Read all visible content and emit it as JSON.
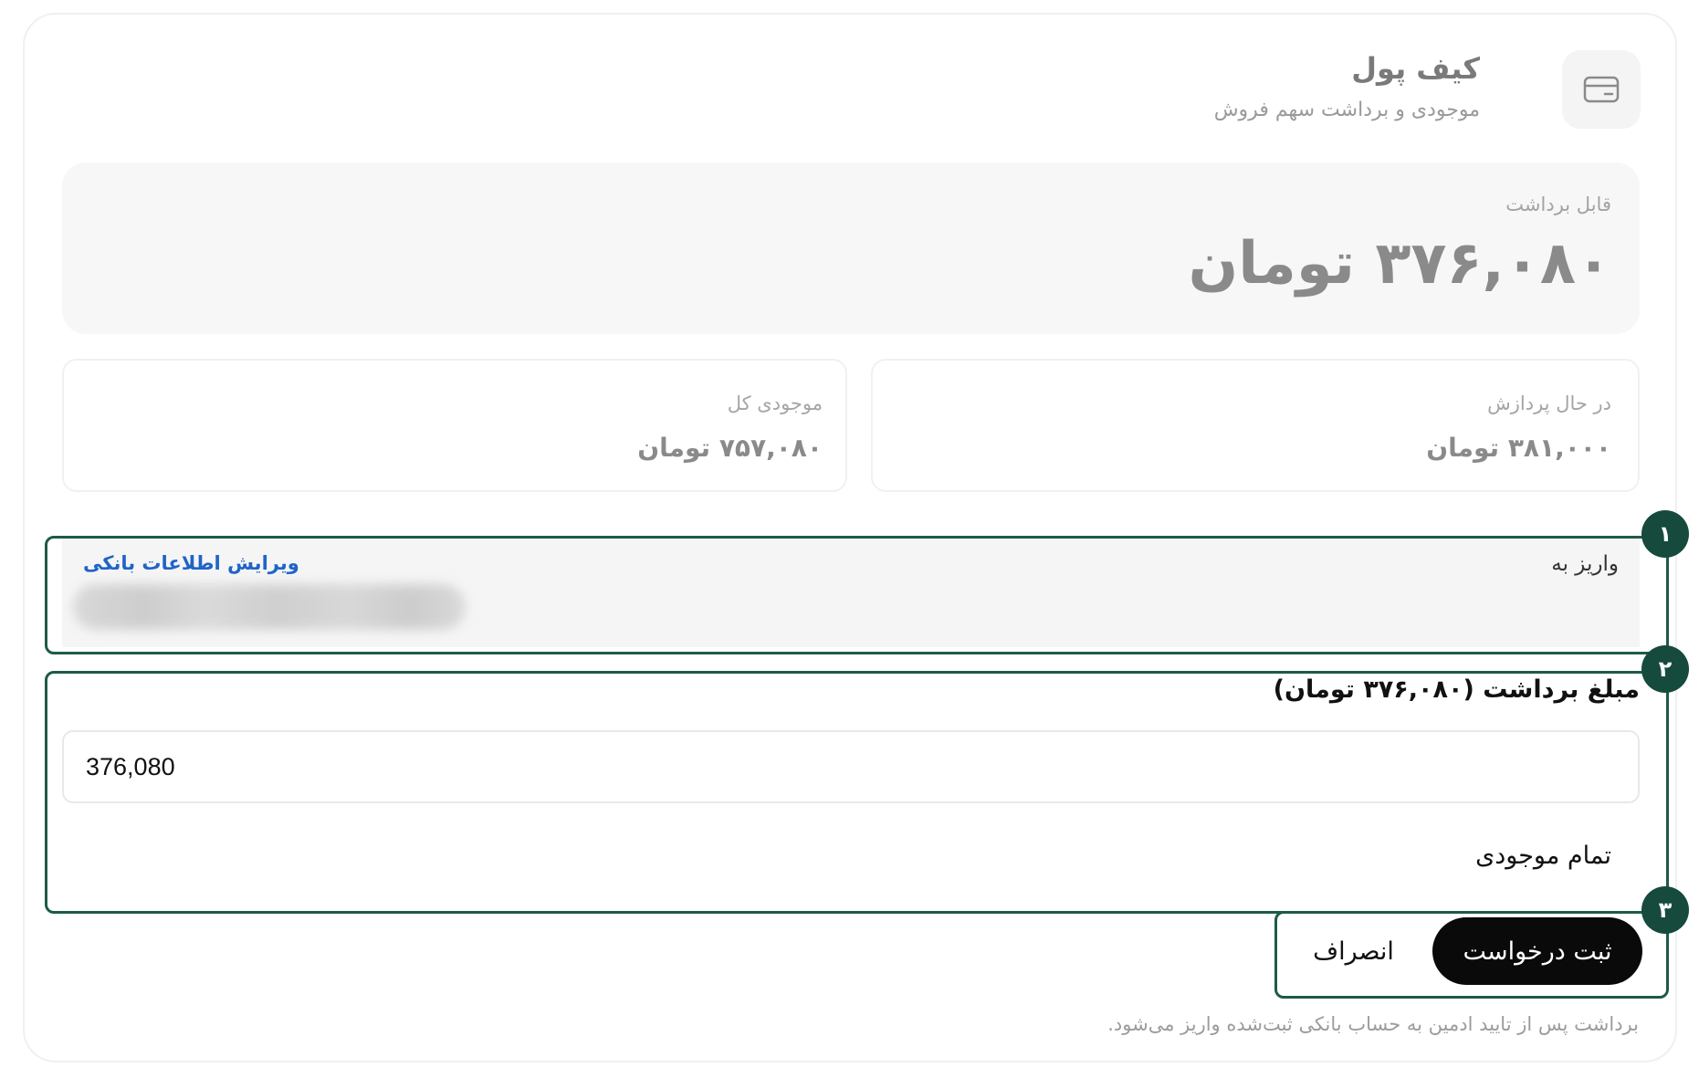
{
  "header": {
    "icon": "wallet-card-icon",
    "title": "کیف پول",
    "subtitle": "موجودی و برداشت سهم فروش"
  },
  "withdrawable": {
    "label": "قابل برداشت",
    "amount": "۳۷۶,۰۸۰ تومان"
  },
  "stats": {
    "processing": {
      "label": "در حال پردازش",
      "value": "۳۸۱,۰۰۰ تومان"
    },
    "total": {
      "label": "موجودی کل",
      "value": "۷۵۷,۰۸۰ تومان"
    }
  },
  "deposit": {
    "label": "واریز به",
    "edit_link": "ویرایش اطلاعات بانکی"
  },
  "amount": {
    "label": "مبلغ برداشت (۳۷۶,۰۸۰ تومان)",
    "value": "376,080",
    "all_balance": "تمام موجودی"
  },
  "actions": {
    "submit": "ثبت درخواست",
    "cancel": "انصراف"
  },
  "note": "برداشت پس از تایید ادمین به حساب بانکی ثبت‌شده واریز می‌شود.",
  "badges": [
    "۱",
    "۲",
    "۳"
  ],
  "colors": {
    "badge": "#164a3c",
    "frame": "#1e5a48",
    "link": "#1f64c8",
    "primary_button": "#0a0a0a"
  }
}
